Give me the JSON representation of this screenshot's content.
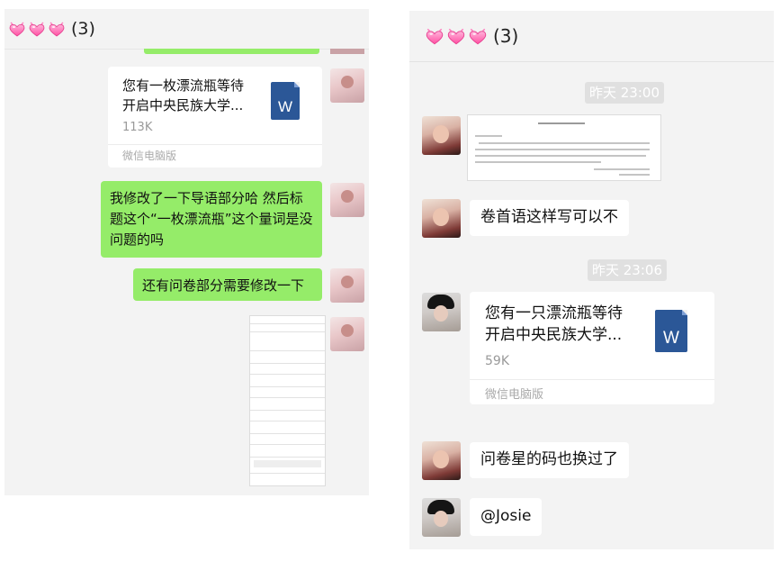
{
  "left": {
    "header": {
      "count": "(3)",
      "hearts": [
        "heart-icon",
        "heart-icon",
        "heart-icon"
      ]
    },
    "messages": {
      "file": {
        "name": "您有一枚漂流瓶等待\n开启中央民族大学...",
        "size": "113K",
        "source": "微信电脑版",
        "icon_letter": "W"
      },
      "msg1": "我修改了一下导语部分哈 然后标题这个“一枚漂流瓶”这个量词是没问题的吗",
      "msg2": "还有问卷部分需要修改一下"
    }
  },
  "right": {
    "header": {
      "count": "(3)",
      "hearts": [
        "heart-icon",
        "heart-icon",
        "heart-icon"
      ]
    },
    "time1": "昨天 23:00",
    "msg1": "卷首语这样写可以不",
    "time2": "昨天 23:06",
    "file": {
      "name": "您有一只漂流瓶等待\n开启中央民族大学...",
      "size": "59K",
      "source": "微信电脑版",
      "icon_letter": "W"
    },
    "msg2": "问卷星的码也换过了",
    "msg3": "@Josie"
  },
  "colors": {
    "green_bubble": "#95ec69",
    "chat_bg": "#f3f3f3",
    "word_blue": "#2b5797",
    "heart_pink": "#ff6fb5"
  }
}
